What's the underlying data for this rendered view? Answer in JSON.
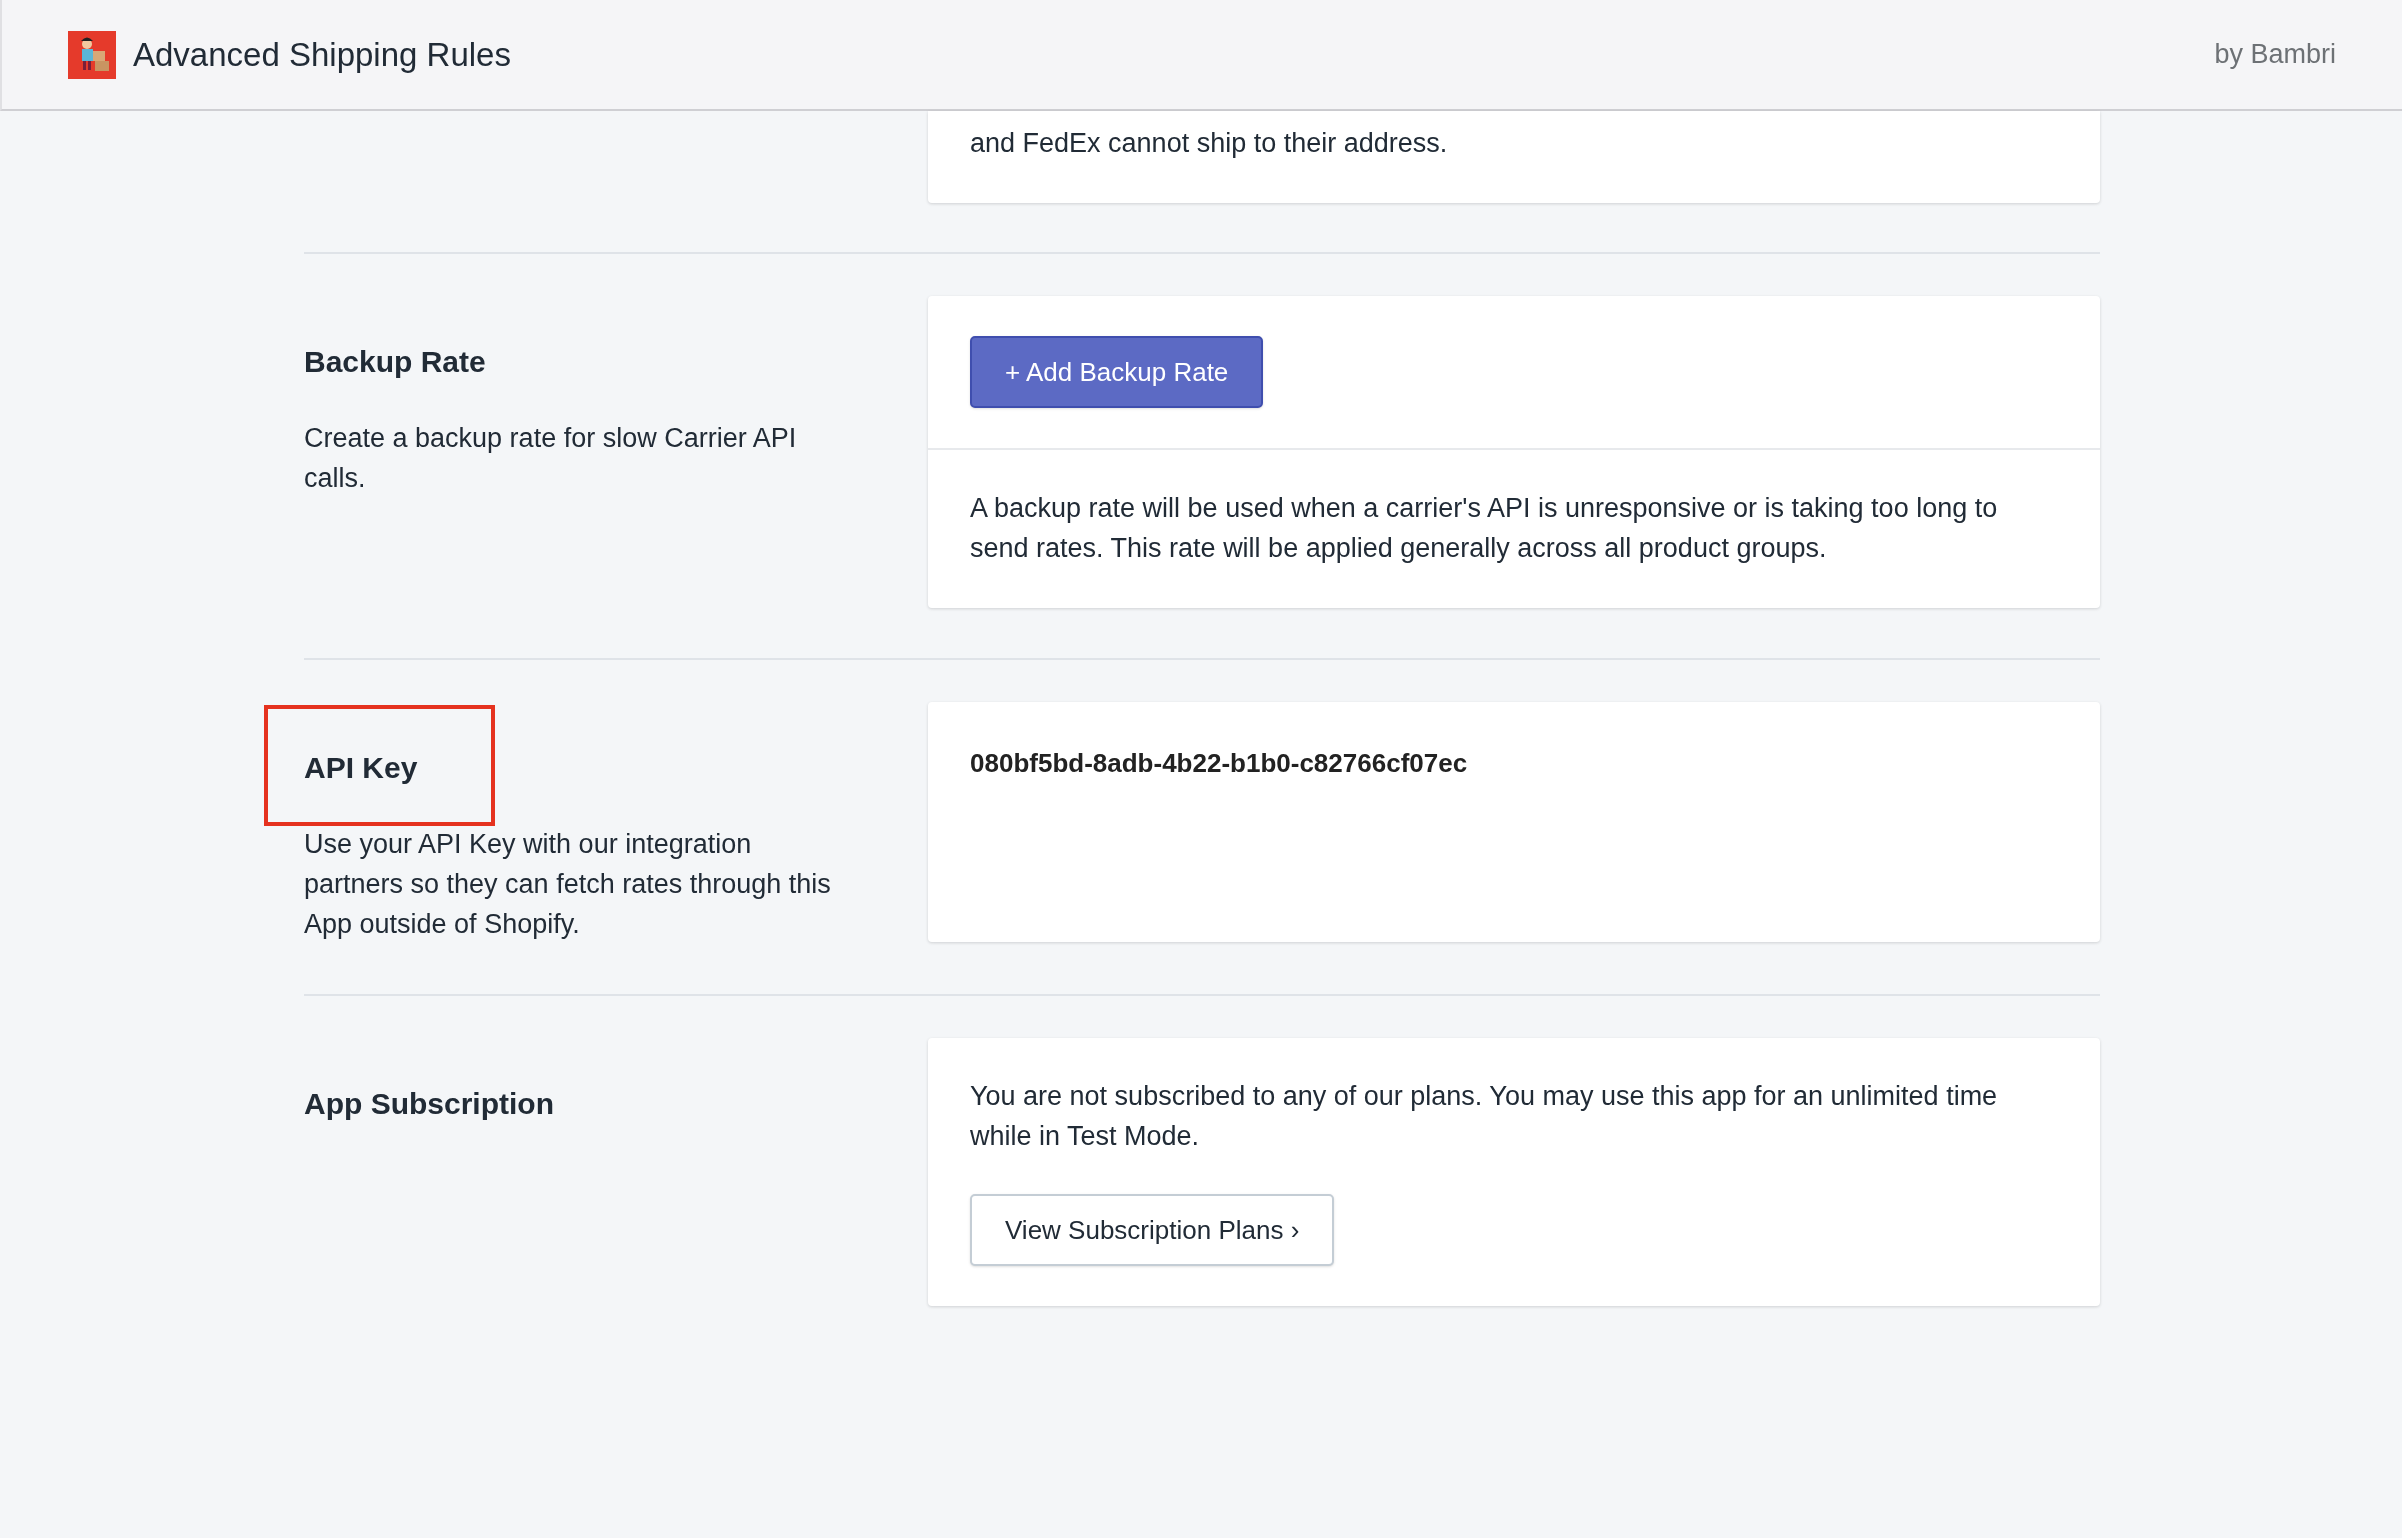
{
  "header": {
    "title": "Advanced Shipping Rules",
    "byline": "by Bambri"
  },
  "sections": [
    {
      "kind": "text_only",
      "card_text": "and FedEx cannot ship to their address.",
      "highlighted": false
    },
    {
      "kind": "button_then_text",
      "heading": "Backup Rate",
      "description": "Create a backup rate for slow Carrier API calls.",
      "button": {
        "label": "+ Add Backup Rate"
      },
      "card_text": "A backup rate will be used when a carrier's API is unresponsive or is taking too long to send rates. This rate will be applied generally across all product groups.",
      "highlighted": false
    },
    {
      "kind": "api_key",
      "heading": "API Key",
      "description": "Use your API Key with our integration partners so they can fetch rates through this App outside of Shopify.",
      "api_key": "080bf5bd-8adb-4b22-b1b0-c82766cf07ec",
      "highlighted": true
    },
    {
      "kind": "text_then_button",
      "heading": "App Subscription",
      "card_text": "You are not subscribed to any of our plans. You may use this app for an unlimited time while in Test Mode.",
      "button": {
        "label": "View Subscription Plans ›"
      },
      "highlighted": false
    }
  ]
}
